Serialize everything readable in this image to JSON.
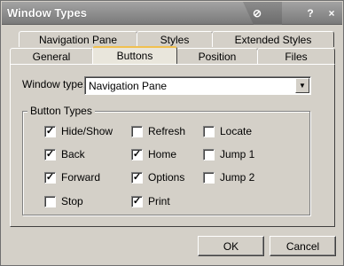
{
  "window": {
    "title": "Window Types",
    "pin_glyph": "⊘",
    "help_glyph": "?",
    "close_glyph": "×"
  },
  "tabs": {
    "row_back": [
      "Navigation Pane",
      "Styles",
      "Extended Styles"
    ],
    "row_front": [
      "General",
      "Buttons",
      "Position",
      "Files"
    ],
    "active": "Buttons"
  },
  "window_type": {
    "label": "Window type:",
    "value": "Navigation Pane",
    "dropdown_icon": "chevron-down-icon"
  },
  "button_types": {
    "title": "Button Types",
    "items": [
      {
        "label": "Hide/Show",
        "checked": true
      },
      {
        "label": "Back",
        "checked": true
      },
      {
        "label": "Forward",
        "checked": true
      },
      {
        "label": "Stop",
        "checked": false
      },
      {
        "label": "Refresh",
        "checked": false
      },
      {
        "label": "Home",
        "checked": true
      },
      {
        "label": "Options",
        "checked": true
      },
      {
        "label": "Print",
        "checked": true
      },
      {
        "label": "Locate",
        "checked": false
      },
      {
        "label": "Jump 1",
        "checked": false
      },
      {
        "label": "Jump 2",
        "checked": false
      }
    ]
  },
  "footer": {
    "ok_label": "OK",
    "cancel_label": "Cancel"
  },
  "colors": {
    "titlebar": "#8e8e8e",
    "face": "#d4d0c8",
    "active_tab_accent": "#f0c050"
  }
}
